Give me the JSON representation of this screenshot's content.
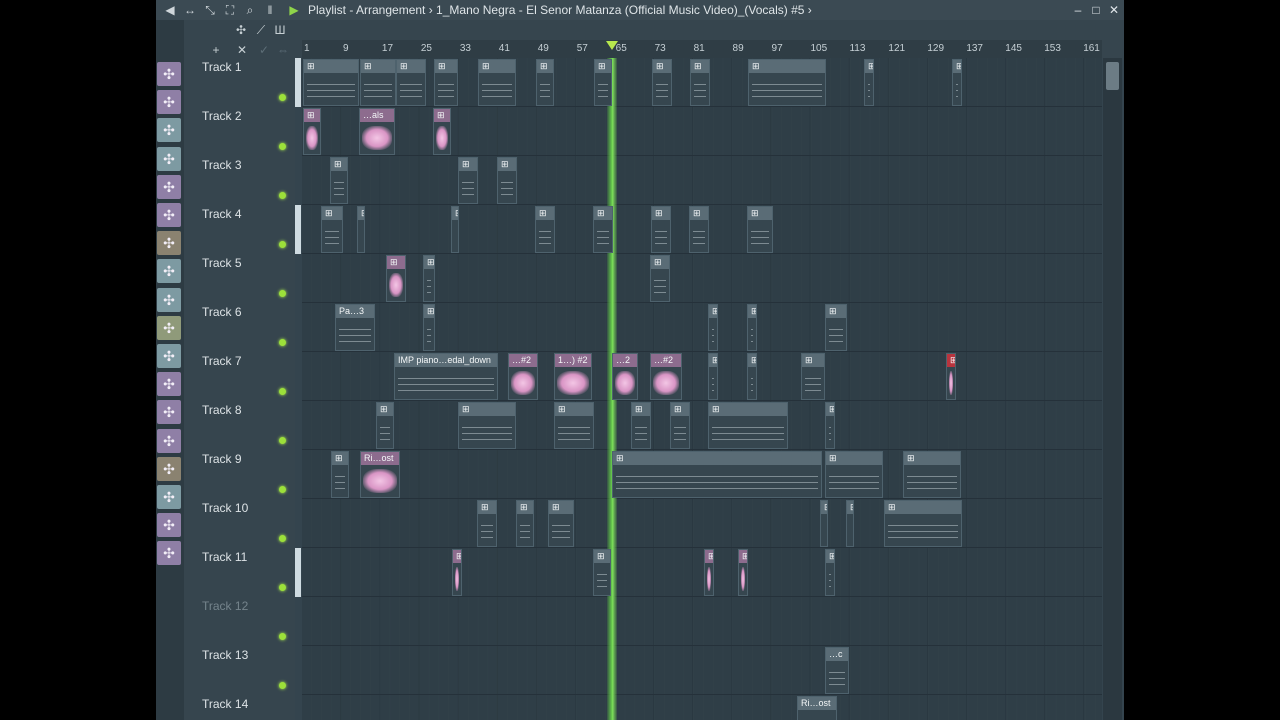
{
  "window": {
    "breadcrumb": "Playlist - Arrangement › 1_Mano Negra - El Senor Matanza (Official Music Video)_(Vocals) #5 ›",
    "controls": {
      "minimize": "–",
      "maximize": "□",
      "close": "✕"
    }
  },
  "ruler": {
    "bars": [
      "1",
      "9",
      "17",
      "25",
      "33",
      "41",
      "49",
      "57",
      "65",
      "73",
      "81",
      "89",
      "97",
      "105",
      "113",
      "121",
      "129",
      "137",
      "145",
      "153",
      "161"
    ]
  },
  "tracks": [
    {
      "label": "Track 1",
      "muted": false
    },
    {
      "label": "Track 2",
      "muted": false
    },
    {
      "label": "Track 3",
      "muted": false
    },
    {
      "label": "Track 4",
      "muted": false
    },
    {
      "label": "Track 5",
      "muted": false
    },
    {
      "label": "Track 6",
      "muted": false
    },
    {
      "label": "Track 7",
      "muted": false
    },
    {
      "label": "Track 8",
      "muted": false
    },
    {
      "label": "Track 9",
      "muted": false
    },
    {
      "label": "Track 10",
      "muted": false
    },
    {
      "label": "Track 11",
      "muted": false
    },
    {
      "label": "Track 12",
      "muted": true
    },
    {
      "label": "Track 13",
      "muted": false
    },
    {
      "label": "Track 14",
      "muted": false
    }
  ],
  "clips": [
    {
      "track": 2,
      "label": "…als",
      "type": "audio"
    },
    {
      "track": 6,
      "label": "Pa…3",
      "type": "pattern"
    },
    {
      "track": 7,
      "label": "IMP piano…edal_down",
      "type": "pattern"
    },
    {
      "track": 7,
      "label": "…#2",
      "type": "audio"
    },
    {
      "track": 7,
      "label": "1…) #2",
      "type": "audio"
    },
    {
      "track": 7,
      "label": "…2",
      "type": "audio"
    },
    {
      "track": 7,
      "label": "…#2",
      "type": "audio"
    },
    {
      "track": 9,
      "label": "Ri…ost",
      "type": "audio"
    },
    {
      "track": 13,
      "label": "…c",
      "type": "pattern"
    },
    {
      "track": 14,
      "label": "Ri…ost",
      "type": "pattern"
    }
  ],
  "playhead_bar": 64
}
